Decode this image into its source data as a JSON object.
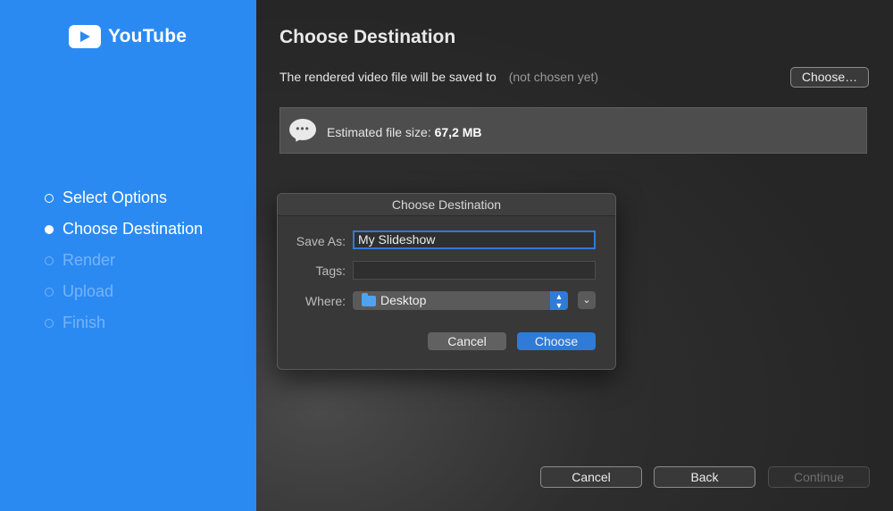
{
  "sidebar": {
    "brand": "YouTube",
    "steps": [
      {
        "label": "Select Options",
        "state": "done"
      },
      {
        "label": "Choose Destination",
        "state": "current"
      },
      {
        "label": "Render",
        "state": "disabled"
      },
      {
        "label": "Upload",
        "state": "disabled"
      },
      {
        "label": "Finish",
        "state": "disabled"
      }
    ]
  },
  "main": {
    "title": "Choose Destination",
    "saved_to_label": "The rendered video file will be saved to",
    "saved_to_value": "(not chosen yet)",
    "choose_button": "Choose…",
    "info_prefix": "Estimated file size: ",
    "info_value": "67,2 MB",
    "buttons": {
      "cancel": "Cancel",
      "back": "Back",
      "continue": "Continue"
    }
  },
  "dialog": {
    "title": "Choose Destination",
    "save_as_label": "Save As:",
    "save_as_value": "My Slideshow",
    "tags_label": "Tags:",
    "tags_value": "",
    "where_label": "Where:",
    "where_value": "Desktop",
    "cancel": "Cancel",
    "choose": "Choose"
  },
  "colors": {
    "sidebar": "#2b8af2",
    "accent": "#2f7bd8"
  },
  "icons": [
    "youtube-logo-icon",
    "speech-bubble-icon",
    "folder-icon",
    "up-down-chevron-icon",
    "chevron-down-icon"
  ]
}
